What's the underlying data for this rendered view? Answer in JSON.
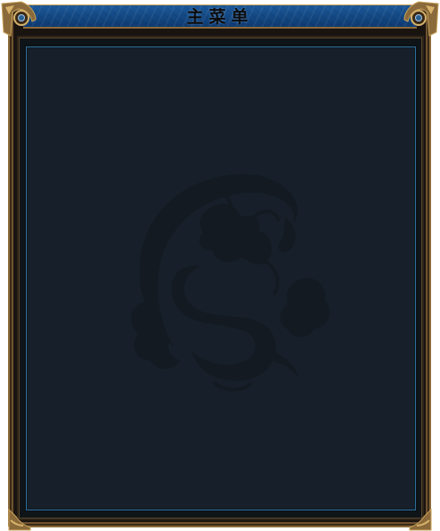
{
  "window": {
    "title": "主菜单"
  },
  "content_panel": {
    "emblem_icon": "dragon-emblem-icon"
  },
  "colors": {
    "titlebar_blue": "#144a86",
    "frame_gold": "#8a6a3a",
    "panel_bg": "#17202a",
    "panel_border": "#2f6f99"
  }
}
